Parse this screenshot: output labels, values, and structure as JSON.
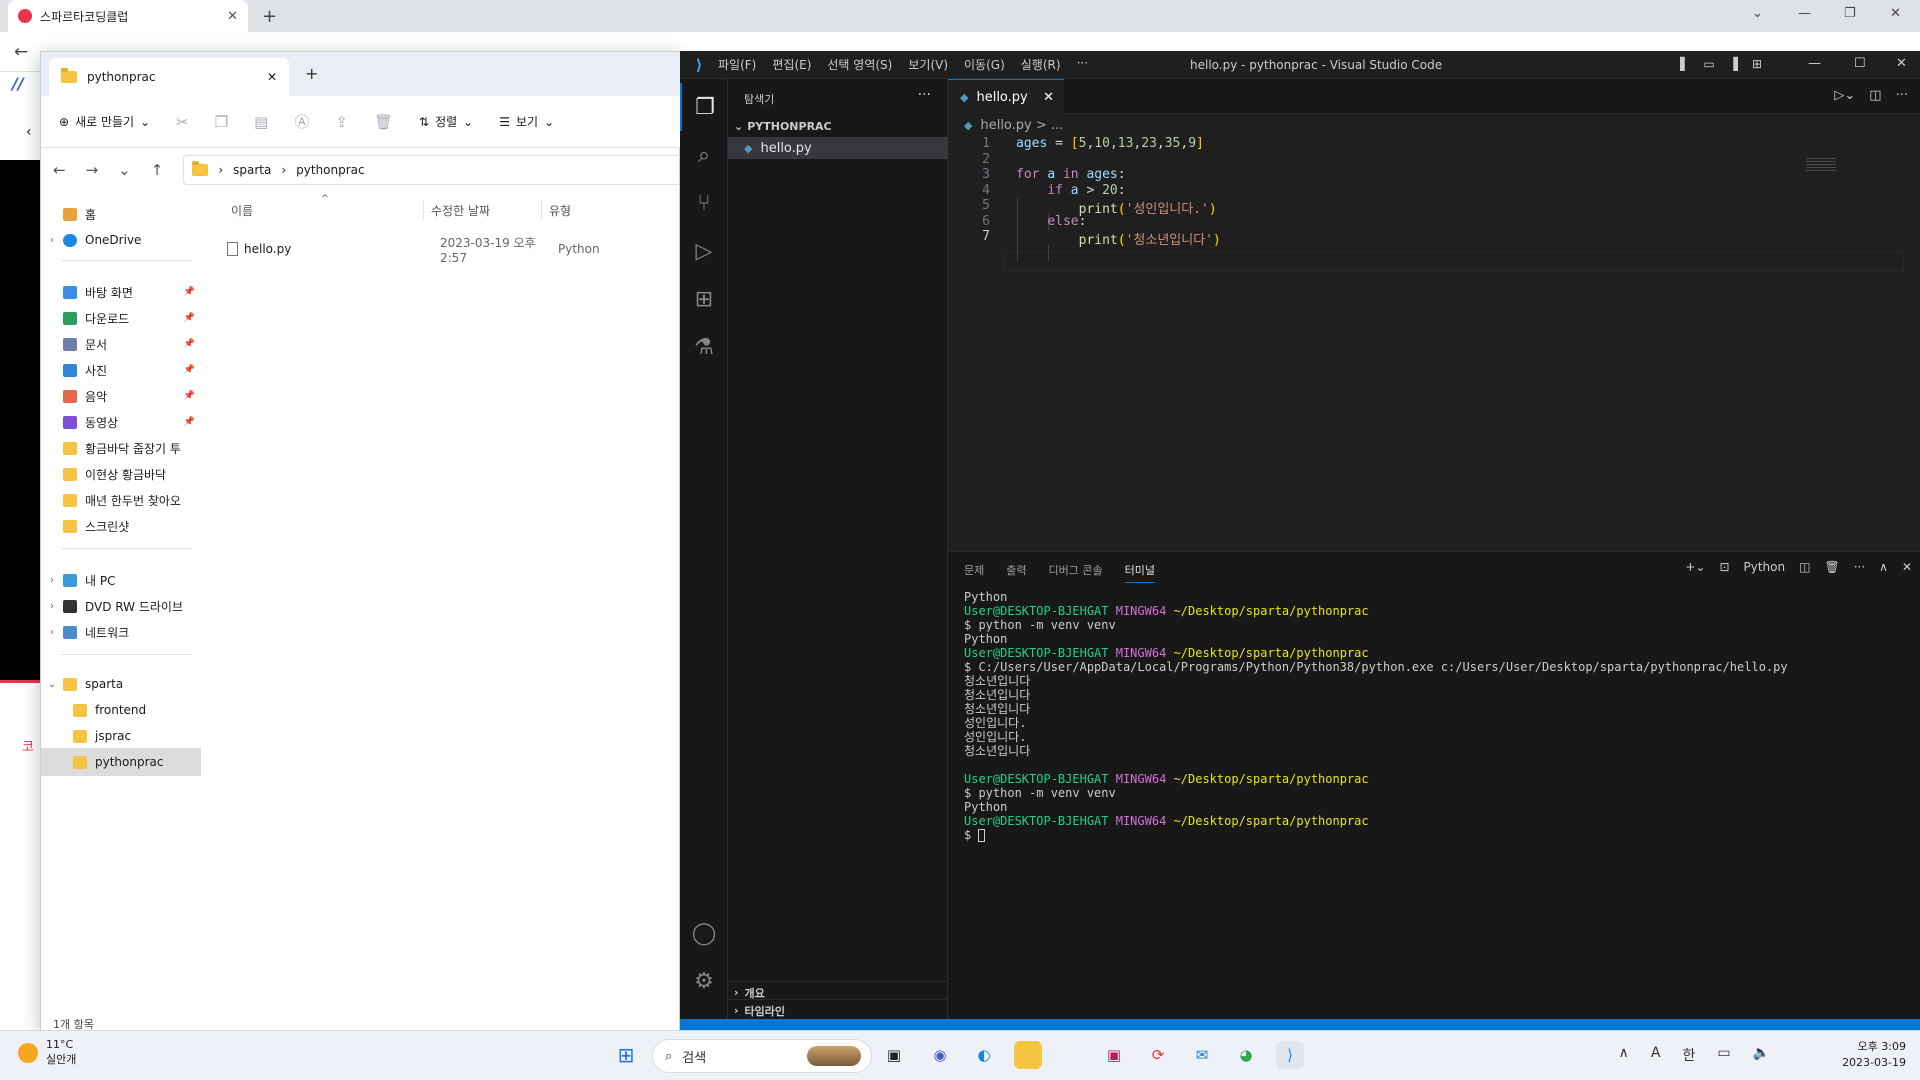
{
  "browser": {
    "tab_title": "스파르타코딩클럽",
    "partial_korean": "코"
  },
  "explorer": {
    "tab_title": "pythonprac",
    "toolbar": {
      "new_label": "새로 만들기",
      "sort_label": "정렬",
      "view_label": "보기"
    },
    "breadcrumb": [
      "sparta",
      "pythonprac"
    ],
    "sidebar": {
      "home": "홈",
      "onedrive": "OneDrive",
      "quick": [
        {
          "label": "바탕 화면",
          "color": "#3a8ee6"
        },
        {
          "label": "다운로드",
          "color": "#2a9d5c"
        },
        {
          "label": "문서",
          "color": "#6b7fa8"
        },
        {
          "label": "사진",
          "color": "#2f86d6"
        },
        {
          "label": "음악",
          "color": "#e4694a"
        },
        {
          "label": "동영상",
          "color": "#7c4dd6"
        },
        {
          "label": "황금바닥 줍장기 투",
          "color": "#f6c443"
        },
        {
          "label": "이현상 황금바닥",
          "color": "#f6c443"
        },
        {
          "label": "매년 한두번 찾아오",
          "color": "#f6c443"
        },
        {
          "label": "스크린샷",
          "color": "#f6c443"
        }
      ],
      "mypc": "내 PC",
      "dvd": "DVD RW 드라이브",
      "network": "네트워크",
      "sparta": "sparta",
      "children": [
        "frontend",
        "jsprac",
        "pythonprac"
      ]
    },
    "columns": {
      "name": "이름",
      "modified": "수정한 날짜",
      "type": "유형"
    },
    "files": [
      {
        "name": "hello.py",
        "modified": "2023-03-19 오후 2:57",
        "type": "Python File"
      }
    ],
    "status": "1개 항목"
  },
  "vscode": {
    "menu": [
      "파일(F)",
      "편집(E)",
      "선택 영역(S)",
      "보기(V)",
      "이동(G)",
      "실행(R)",
      "···"
    ],
    "window_title": "hello.py - pythonprac - Visual Studio Code",
    "sidebar_header": "탐색기",
    "project": "PYTHONPRAC",
    "file": "hello.py",
    "outline": "개요",
    "timeline": "타임라인",
    "tab": "hello.py",
    "breadcrumb": "hello.py > ...",
    "line_numbers": [
      "1",
      "2",
      "3",
      "4",
      "5",
      "6",
      "7"
    ],
    "panel_tabs": [
      "문제",
      "출력",
      "디버그 콘솔",
      "터미널"
    ],
    "terminal_profile": "Python",
    "terminal": {
      "user": "User@DESKTOP-BJEHGAT",
      "host": "MINGW64",
      "path": "~/Desktop/sparta/pythonprac",
      "lines": {
        "l0": "Python",
        "l2": "$ python -m venv venv",
        "l3": "Python",
        "l5": "$ C:/Users/User/AppData/Local/Programs/Python/Python38/python.exe c:/Users/User/Desktop/sparta/pythonprac/hello.py",
        "l6": "청소년입니다",
        "l7": "청소년입니다",
        "l8": "청소년입니다",
        "l9": "성인입니다.",
        "l10": "성인입니다.",
        "l11": "청소년입니다",
        "l14": "$ python -m venv venv",
        "l15": "Python",
        "l17": "$ "
      }
    }
  },
  "taskbar": {
    "temp": "11°C",
    "weather": "실안개",
    "search": "검색",
    "ime_a": "A",
    "ime_ko": "한",
    "time": "오후 3:09",
    "date": "2023-03-19"
  }
}
